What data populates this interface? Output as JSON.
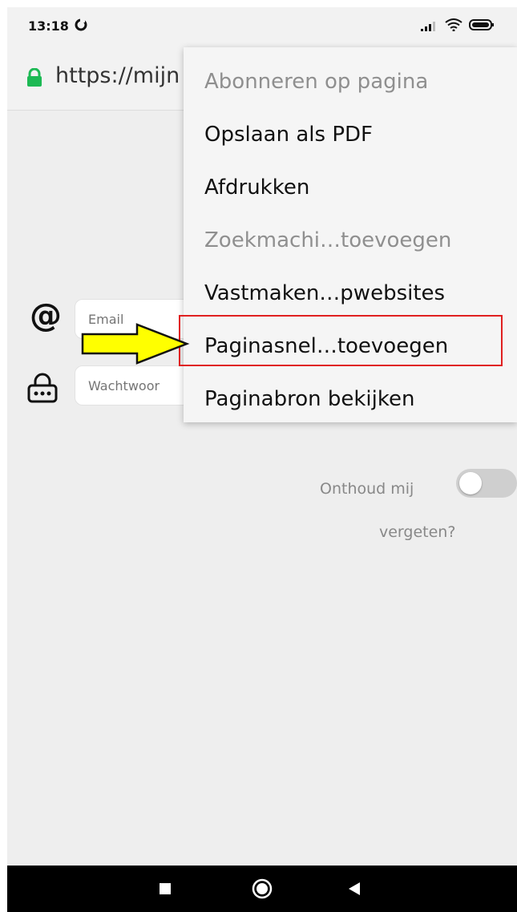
{
  "status_bar": {
    "time": "13:18"
  },
  "browser": {
    "url": "https://mijn"
  },
  "form": {
    "email_placeholder": "Email",
    "password_placeholder": "Wachtwoor",
    "remember_label": "Onthoud mij",
    "remember_checked": false,
    "forgot_label": "vergeten?"
  },
  "menu": {
    "items": [
      {
        "label": "Abonneren op pagina",
        "enabled": false
      },
      {
        "label": "Opslaan als PDF",
        "enabled": true
      },
      {
        "label": "Afdrukken",
        "enabled": true
      },
      {
        "label": "Zoekmachi…toevoegen",
        "enabled": false
      },
      {
        "label": "Vastmaken…pwebsites",
        "enabled": true
      },
      {
        "label": "Paginasnel…toevoegen",
        "enabled": true,
        "highlighted": true
      },
      {
        "label": "Paginabron bekijken",
        "enabled": true
      }
    ]
  },
  "colors": {
    "highlight_border": "#e02020",
    "arrow_fill": "#ffff00",
    "lock_green": "#1db954"
  },
  "icons": [
    "firefox-icon",
    "signal-icon",
    "wifi-icon",
    "battery-icon",
    "lock-icon",
    "at-icon",
    "password-lock-icon",
    "arrow-pointer",
    "nav-recent-icon",
    "nav-home-icon",
    "nav-back-icon"
  ]
}
